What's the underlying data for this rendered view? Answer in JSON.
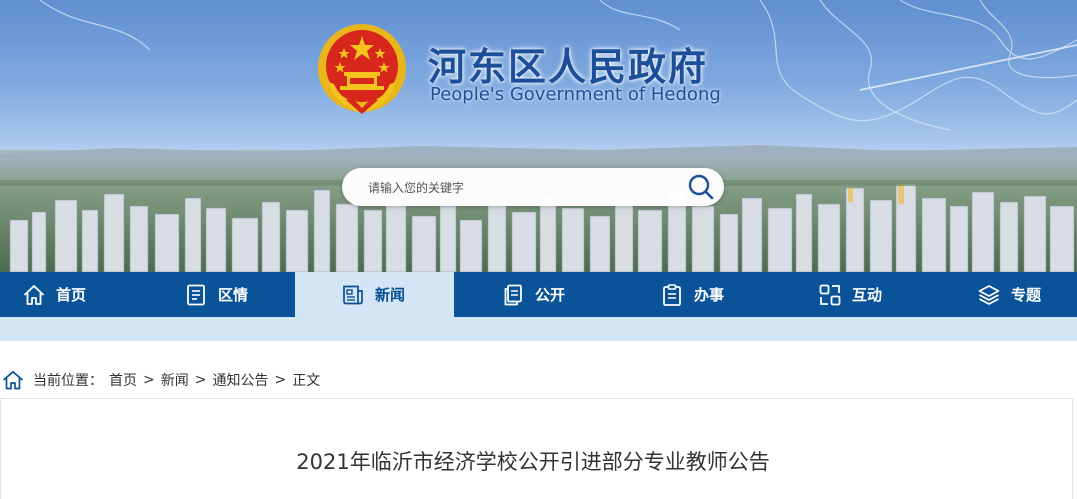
{
  "header": {
    "title": "河东区人民政府",
    "subtitle": "People's Government of Hedong",
    "emblem_icon": "national-emblem-icon"
  },
  "search": {
    "placeholder": "请输入您的关键字",
    "button_icon": "search-icon"
  },
  "nav": {
    "items": [
      {
        "label": "首页",
        "icon": "home-icon"
      },
      {
        "label": "区情",
        "icon": "document-icon"
      },
      {
        "label": "新闻",
        "icon": "newspaper-icon",
        "active": true
      },
      {
        "label": "公开",
        "icon": "files-icon"
      },
      {
        "label": "办事",
        "icon": "clipboard-icon"
      },
      {
        "label": "互动",
        "icon": "interaction-icon"
      },
      {
        "label": "专题",
        "icon": "layers-icon"
      }
    ]
  },
  "breadcrumb": {
    "prefix": "当前位置：",
    "items": [
      "首页",
      "新闻",
      "通知公告",
      "正文"
    ],
    "separator": ">"
  },
  "article": {
    "title": "2021年临沂市经济学校公开引进部分专业教师公告"
  },
  "colors": {
    "nav_bg": "#0a5399",
    "nav_active_bg": "#d4e5f6",
    "title_blue": "#1d4e9a",
    "emblem_red": "#d7261c",
    "emblem_gold": "#f5c41c"
  }
}
